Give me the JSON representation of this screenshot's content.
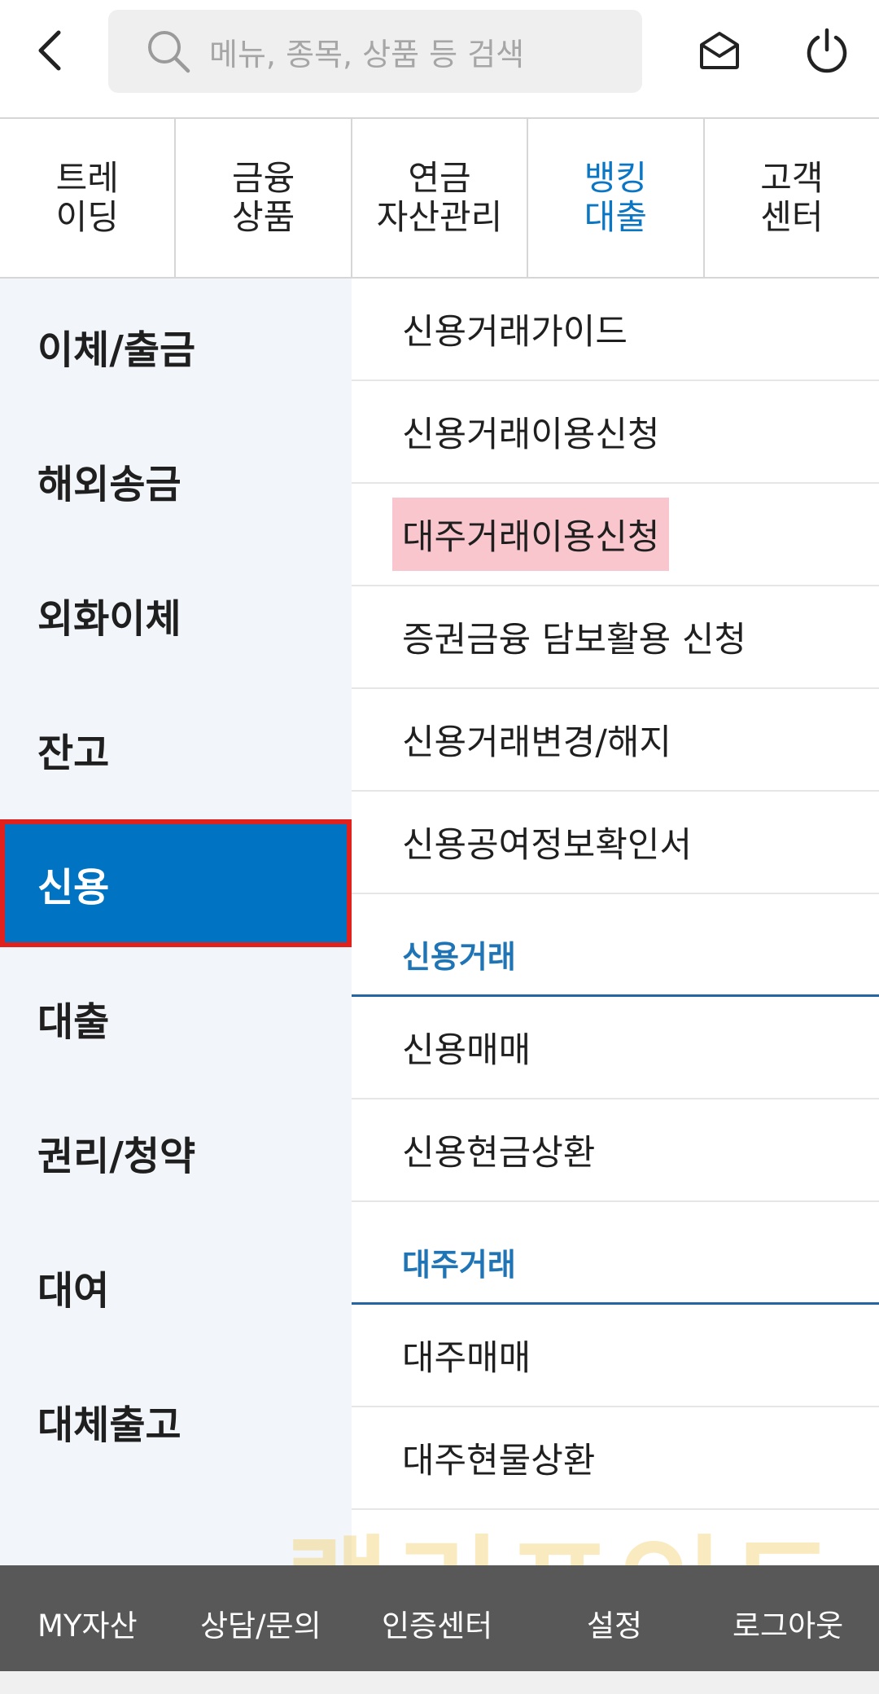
{
  "header": {
    "back_icon": "chevron-left-icon",
    "search_placeholder": "메뉴, 종목, 상품 등 검색",
    "search_icon": "search-icon",
    "mail_icon": "mail-icon",
    "power_icon": "power-icon"
  },
  "tabs": [
    {
      "line1": "트레",
      "line2": "이딩"
    },
    {
      "line1": "금융",
      "line2": "상품"
    },
    {
      "line1": "연금",
      "line2": "자산관리"
    },
    {
      "line1": "뱅킹",
      "line2": "대출"
    },
    {
      "line1": "고객",
      "line2": "센터"
    }
  ],
  "active_tab_color": "#0b76c4",
  "left_menu": {
    "items": [
      "이체/출금",
      "해외송금",
      "외화이체",
      "잔고",
      "신용",
      "대출",
      "권리/청약",
      "대여",
      "대체출고"
    ],
    "active": "신용",
    "active_color": "#0074c2",
    "highlight_border_color": "#e2211c"
  },
  "sub_menu": {
    "items": [
      "신용거래가이드",
      "신용거래이용신청",
      "대주거래이용신청",
      "증권금융 담보활용 신청",
      "신용거래변경/해지",
      "신용공여정보확인서"
    ],
    "highlighted": "대주거래이용신청",
    "section_credit": {
      "title": "신용거래",
      "items": [
        "신용매매",
        "신용현금상환"
      ]
    },
    "section_short": {
      "title": "대주거래",
      "items": [
        "대주매매",
        "대주현물상환"
      ]
    }
  },
  "bottom_bar": {
    "items": [
      "MY자산",
      "상담/문의",
      "인증센터",
      "설정",
      "로그아웃"
    ]
  },
  "watermark": "랠리포인트"
}
